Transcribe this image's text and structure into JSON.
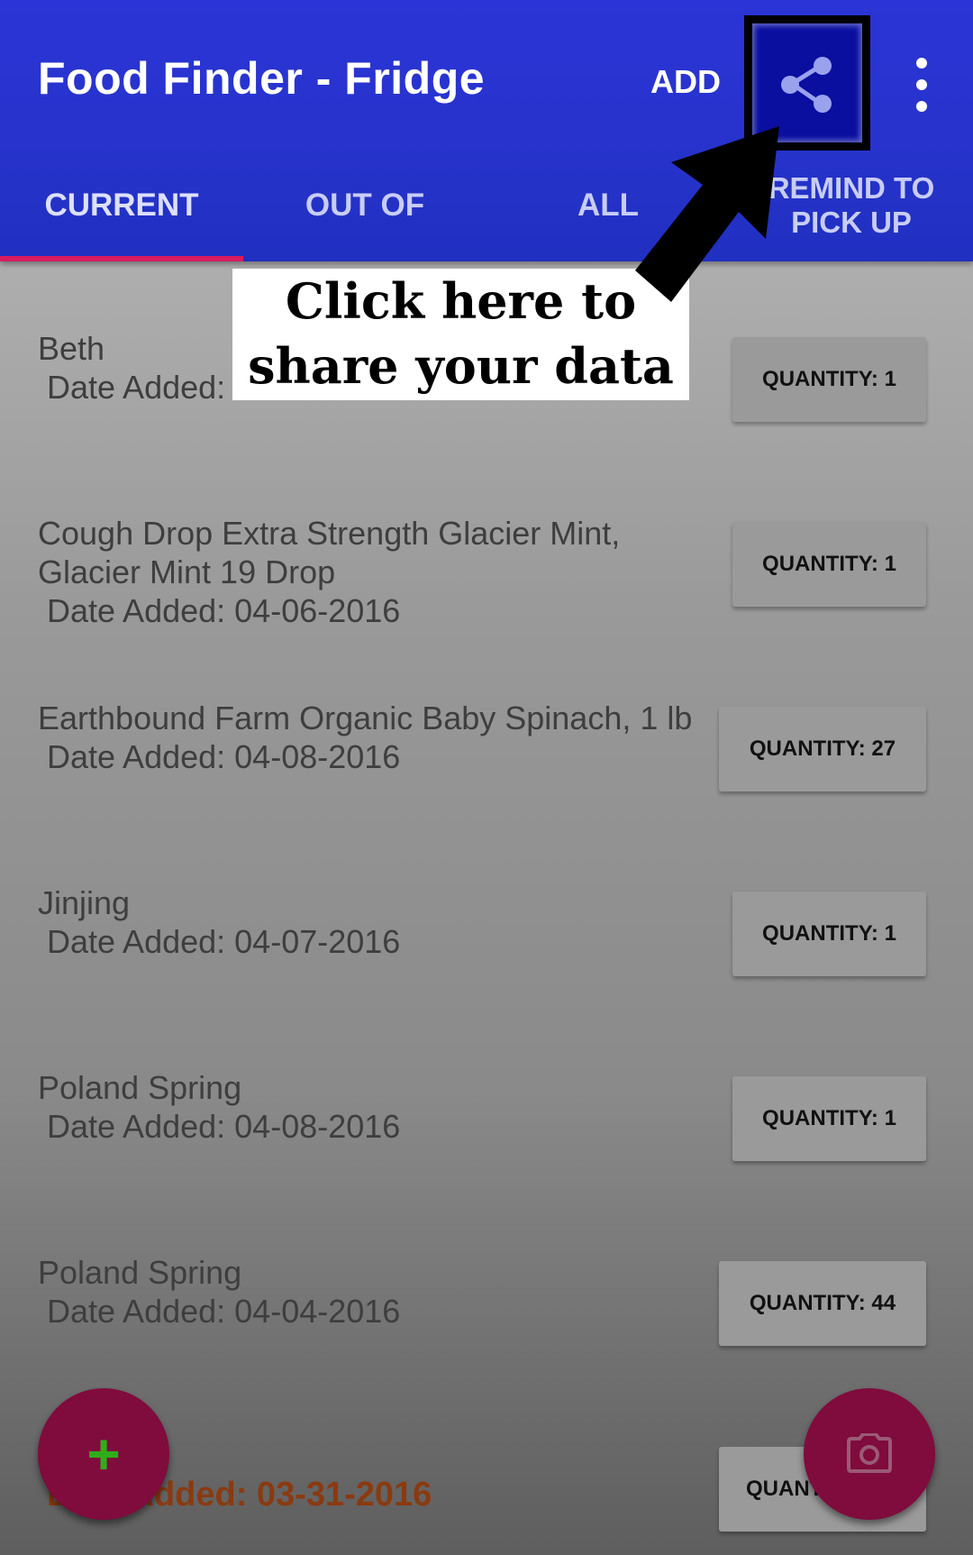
{
  "app": {
    "title": "Food Finder - Fridge"
  },
  "toolbar": {
    "add_label": "ADD",
    "share_icon": "share-icon",
    "overflow_icon": "more-vert-icon"
  },
  "tabs": [
    {
      "label": "CURRENT",
      "active": true
    },
    {
      "label": "OUT OF",
      "active": false
    },
    {
      "label": "ALL",
      "active": false
    },
    {
      "label": "REMIND TO PICK UP",
      "active": false
    }
  ],
  "callout": {
    "line1": "Click here to",
    "line2": "share your data"
  },
  "items": [
    {
      "name": "Beth",
      "date": "Date Added:",
      "quantity": "QUANTITY: 1"
    },
    {
      "name_line1": "Cough Drop Extra Strength Glacier Mint,",
      "name_line2": "Glacier Mint 19 Drop",
      "date": "Date Added: 04-06-2016",
      "quantity": "QUANTITY: 1"
    },
    {
      "name": "Earthbound Farm Organic Baby Spinach, 1 lb",
      "date": "Date Added: 04-08-2016",
      "quantity": "QUANTITY: 27"
    },
    {
      "name": "Jinjing",
      "date": "Date Added: 04-07-2016",
      "quantity": "QUANTITY: 1"
    },
    {
      "name": "Poland Spring",
      "date": "Date Added: 04-08-2016",
      "quantity": "QUANTITY: 1"
    },
    {
      "name": "Poland Spring",
      "date": "Date Added: 04-04-2016",
      "quantity": "QUANTITY: 44"
    },
    {
      "date": "Date Added: 03-31-2016",
      "quantity": "QUANTITY:"
    }
  ],
  "fab": {
    "add_icon": "plus-icon",
    "camera_icon": "camera-icon"
  },
  "colors": {
    "appbar": "#2733cc",
    "accent": "#d81b60",
    "fab": "#800b3d"
  }
}
